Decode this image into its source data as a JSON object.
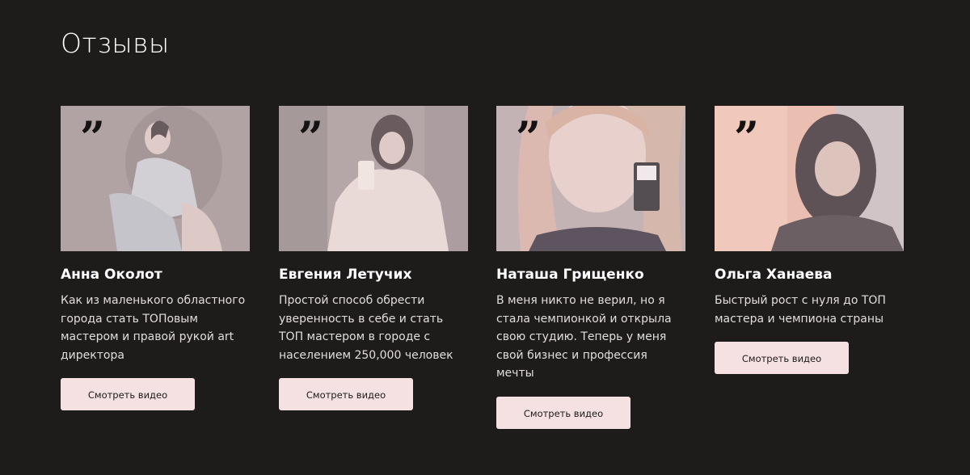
{
  "section": {
    "title": "Отзывы"
  },
  "colors": {
    "background": "#1e1b1b",
    "button": "#f5e1e2",
    "photo_tint": "#f2dcdc"
  },
  "reviews": [
    {
      "name": "Анна Околот",
      "text": "Как из маленького областного города стать ТОПовым мастером и правой рукой art директора",
      "button": "Смотреть видео",
      "quote_icon": "quote-icon"
    },
    {
      "name": "Евгения Летучих",
      "text": "Простой способ обрести уверенность в себе и стать ТОП мастером в городе с населением 250,000 человек",
      "button": "Смотреть видео",
      "quote_icon": "quote-icon"
    },
    {
      "name": "Наташа Грищенко",
      "text": "В меня никто не верил, но я стала чемпионкой и открыла свою студию. Теперь у меня свой бизнес и профессия мечты",
      "button": "Смотреть видео",
      "quote_icon": "quote-icon"
    },
    {
      "name": "Ольга Ханаева",
      "text": "Быстрый рост с нуля до ТОП мастера и чемпиона страны",
      "button": "Смотреть видео",
      "quote_icon": "quote-icon"
    }
  ]
}
